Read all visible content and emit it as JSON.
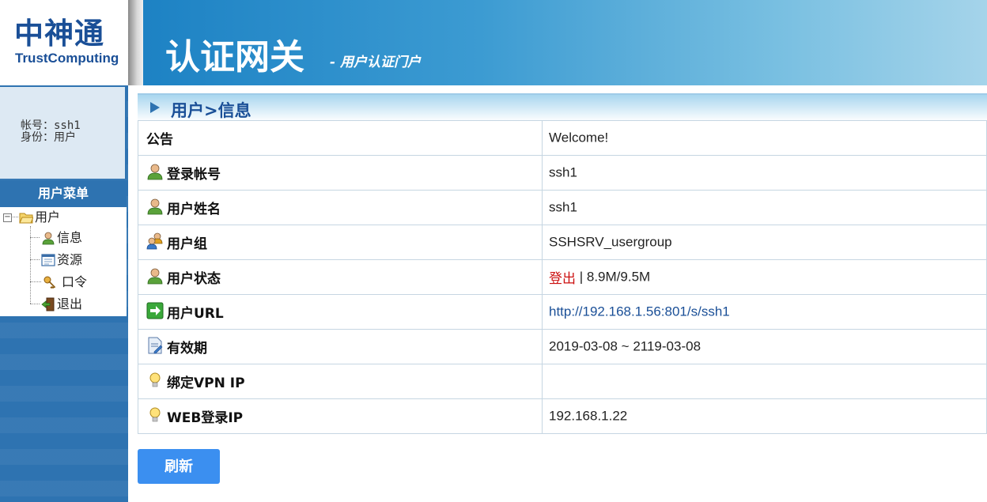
{
  "header": {
    "logo_cn": "中神通",
    "logo_en": "TrustComputing",
    "title": "认证网关",
    "subtitle": "- 用户认证门户"
  },
  "account": {
    "line1": "帐号：ssh1",
    "line2": "身份：用户"
  },
  "menu": {
    "title": "用户菜单",
    "root": "用户",
    "items": [
      {
        "label": "信息",
        "icon": "user-icon"
      },
      {
        "label": "资源",
        "icon": "window-icon"
      },
      {
        "label": "口令",
        "icon": "key-icon"
      },
      {
        "label": "退出",
        "icon": "exit-door-icon"
      }
    ]
  },
  "section": {
    "title": "用户>信息"
  },
  "rows": [
    {
      "label": "公告",
      "value": "Welcome!",
      "icon": ""
    },
    {
      "label": "登录帐号",
      "value": "ssh1",
      "icon": "user-icon"
    },
    {
      "label": "用户姓名",
      "value": "ssh1",
      "icon": "user-icon"
    },
    {
      "label": "用户组",
      "value": "SSHSRV_usergroup",
      "icon": "user-group-icon"
    },
    {
      "label": "用户状态",
      "value_status": "登出",
      "value_sep": " | ",
      "value_quota": "8.9M/9.5M",
      "icon": "user-icon"
    },
    {
      "label": "用户URL",
      "value": "http://192.168.1.56:801/s/ssh1",
      "icon": "green-arrow-icon"
    },
    {
      "label": "有效期",
      "value": "2019-03-08 ~ 2119-03-08",
      "icon": "document-icon"
    },
    {
      "label": "绑定VPN IP",
      "value": "",
      "icon": "lightbulb-icon"
    },
    {
      "label": "WEB登录IP",
      "value": "192.168.1.22",
      "icon": "lightbulb-icon"
    }
  ],
  "actions": {
    "refresh": "刷新"
  },
  "colors": {
    "brand_blue": "#1a4f97",
    "banner_blue": "#1d82c4",
    "sidebar_blue": "#2e73b1",
    "button_blue": "#3b8ff0",
    "logout_red": "#cc1111"
  }
}
